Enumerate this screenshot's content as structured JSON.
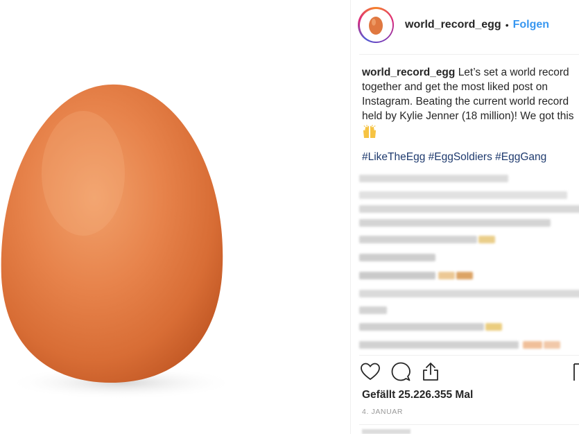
{
  "post": {
    "image_alt": "egg",
    "username": "world_record_egg",
    "separator": "•",
    "follow_label": "Folgen",
    "caption_user": "world_record_egg",
    "caption_lines": [
      "Let’s set a world record",
      "together and get the most liked post on",
      "Instagram. Beating the current world record",
      "held by Kylie Jenner (18 million)! We got this"
    ],
    "caption_emoji": "raising-hands-emoji",
    "hashtags": "#LikeTheEgg #EggSoldiers #EggGang",
    "likes_text": "Gefällt 25.226.355 Mal",
    "date_text": "4. JANUAR"
  },
  "colors": {
    "link_blue": "#3897f0",
    "hashtag_blue": "#1e3a6e",
    "egg_orange": "#e07840",
    "text_dark": "#262626",
    "muted_gray": "#999999"
  },
  "icons": [
    "heart-icon",
    "comment-icon",
    "share-icon",
    "bookmark-icon"
  ]
}
